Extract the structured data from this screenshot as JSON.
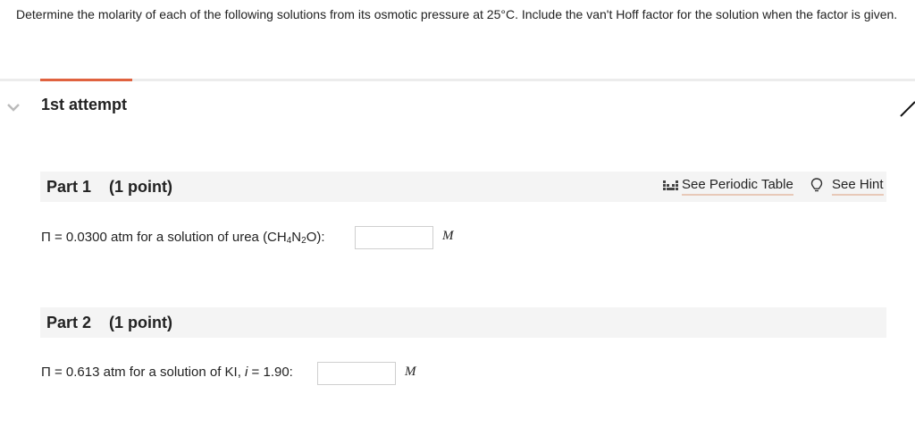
{
  "question": {
    "text": "Determine the molarity of each of the following solutions from its osmotic pressure at 25°C. Include the van't Hoff factor for the solution when the factor is given."
  },
  "attempt": {
    "title": "1st attempt"
  },
  "tools": {
    "periodic_table": "See Periodic Table",
    "hint": "See Hint"
  },
  "parts": [
    {
      "label": "Part 1",
      "points": "(1 point)",
      "prompt_lead": "Π = 0.0300 atm for a solution of urea (CH",
      "sub1": "4",
      "mid": "N",
      "sub2": "2",
      "tail": "O):",
      "input_value": "",
      "unit": "M"
    },
    {
      "label": "Part 2",
      "points": "(1 point)",
      "prompt_lead": "Π = 0.613 atm for a solution of KI, ",
      "i_symbol": "i",
      "tail": " = 1.90:",
      "input_value": "",
      "unit": "M"
    }
  ],
  "colors": {
    "accent": "#e0623f",
    "bar": "#f4f4f4",
    "link_underline": "#e8c9b8"
  }
}
